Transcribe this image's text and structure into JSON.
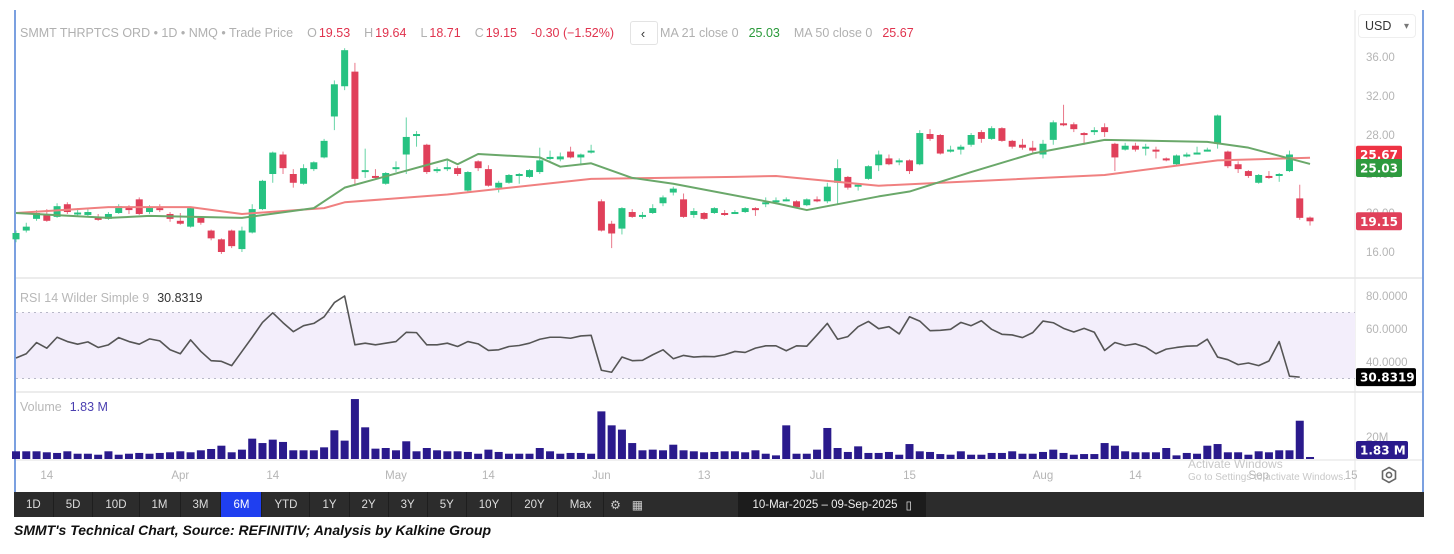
{
  "legend": {
    "symbol_line": "SMMT THRPTCS ORD • 1D • NMQ • Trade Price",
    "open_label": "O",
    "open": "19.53",
    "high_label": "H",
    "high": "19.64",
    "low_label": "L",
    "low": "18.71",
    "close_label": "C",
    "close": "19.15",
    "change": "-0.30 (−1.52%)",
    "back_icon": "‹",
    "ma21_label": "MA 21 close 0",
    "ma21_value": "25.03",
    "ma50_label": "MA 50 close 0",
    "ma50_value": "25.67"
  },
  "currency": {
    "value": "USD",
    "arrow": "▾"
  },
  "rsi_pane": {
    "label": "RSI 14 Wilder Simple 9",
    "value": "30.8319"
  },
  "volume_pane": {
    "label": "Volume",
    "value": "1.83 M"
  },
  "colors": {
    "up": "#26c281",
    "down": "#e0405a",
    "ma21": "#6aa86a",
    "ma50": "#f08080",
    "volume": "#2a1a8c",
    "rsi": "#555555",
    "accent": "#1f3ff0"
  },
  "toolbar": {
    "ranges": [
      "1D",
      "5D",
      "10D",
      "1M",
      "3M",
      "6M",
      "YTD",
      "1Y",
      "2Y",
      "3Y",
      "5Y",
      "10Y",
      "20Y",
      "Max"
    ],
    "active": "6M",
    "date_range": "10-Mar-2025  –  09-Sep-2025"
  },
  "watermark": {
    "line1": "Activate Windows",
    "line2": "Go to Settings to activate Windows."
  },
  "caption": "SMMT's Technical Chart, Source: REFINITIV; Analysis by Kalkine Group",
  "chart_data": {
    "type": "candlestick",
    "title": "SMMT THRPTCS ORD • 1D • NMQ • Trade Price",
    "date_range": [
      "10-Mar-2025",
      "09-Sep-2025"
    ],
    "x_tick_labels": [
      {
        "label": "14",
        "index": 3
      },
      {
        "label": "Apr",
        "index": 16
      },
      {
        "label": "14",
        "index": 25
      },
      {
        "label": "May",
        "index": 37
      },
      {
        "label": "14",
        "index": 46
      },
      {
        "label": "Jun",
        "index": 57
      },
      {
        "label": "13",
        "index": 67
      },
      {
        "label": "Jul",
        "index": 78
      },
      {
        "label": "15",
        "index": 87
      },
      {
        "label": "Aug",
        "index": 100
      },
      {
        "label": "14",
        "index": 109
      },
      {
        "label": "Sep",
        "index": 121
      },
      {
        "label": "15",
        "index": 130
      }
    ],
    "price_axis": {
      "ticks": [
        "36.00",
        "32.00",
        "28.00",
        "24.00",
        "20.00",
        "16.00"
      ],
      "range": [
        14.8,
        38.2
      ]
    },
    "price_markers": [
      {
        "label": "25.67",
        "value": 25.67,
        "color": "#ee3344"
      },
      {
        "label": "25.03",
        "value": 25.03,
        "color": "#2e9a3e"
      },
      {
        "label": "19.15",
        "value": 19.15,
        "color": "#e0405a"
      }
    ],
    "ohlc": [
      [
        17.3,
        18.2,
        17.0,
        17.95
      ],
      [
        18.2,
        19.0,
        18.0,
        18.6
      ],
      [
        19.4,
        20.3,
        19.2,
        20.0
      ],
      [
        19.8,
        20.4,
        19.1,
        19.2
      ],
      [
        19.6,
        21.0,
        19.5,
        20.7
      ],
      [
        20.9,
        21.1,
        19.9,
        20.1
      ],
      [
        20.0,
        20.5,
        19.6,
        20.05
      ],
      [
        19.8,
        20.4,
        19.6,
        20.1
      ],
      [
        19.5,
        19.9,
        19.2,
        19.4
      ],
      [
        19.4,
        20.1,
        19.3,
        19.9
      ],
      [
        20.0,
        20.9,
        19.9,
        20.7
      ],
      [
        20.6,
        20.8,
        19.9,
        20.3
      ],
      [
        21.4,
        21.6,
        19.8,
        19.9
      ],
      [
        20.1,
        20.8,
        19.9,
        20.6
      ],
      [
        20.5,
        20.9,
        20.1,
        20.4
      ],
      [
        19.9,
        20.1,
        19.1,
        19.4
      ],
      [
        19.2,
        20.0,
        18.8,
        18.9
      ],
      [
        18.6,
        20.6,
        18.5,
        20.5
      ],
      [
        19.5,
        19.6,
        18.8,
        19.0
      ],
      [
        18.2,
        18.3,
        17.2,
        17.4
      ],
      [
        17.3,
        17.4,
        15.8,
        16.0
      ],
      [
        18.2,
        18.3,
        16.4,
        16.6
      ],
      [
        16.3,
        18.6,
        16.0,
        18.2
      ],
      [
        18.0,
        20.9,
        17.9,
        20.4
      ],
      [
        20.4,
        23.4,
        20.3,
        23.3
      ],
      [
        24.0,
        26.3,
        23.1,
        26.2
      ],
      [
        26.0,
        26.3,
        24.0,
        24.6
      ],
      [
        24.0,
        24.5,
        22.6,
        23.1
      ],
      [
        23.0,
        25.0,
        22.9,
        24.6
      ],
      [
        24.5,
        25.3,
        24.3,
        25.2
      ],
      [
        25.7,
        27.6,
        25.6,
        27.4
      ],
      [
        29.9,
        33.6,
        28.5,
        33.2
      ],
      [
        33.0,
        36.9,
        32.6,
        36.7
      ],
      [
        34.5,
        35.4,
        22.8,
        23.5
      ],
      [
        24.3,
        26.6,
        23.6,
        24.4
      ],
      [
        23.8,
        24.5,
        23.5,
        23.7
      ],
      [
        23.0,
        24.2,
        22.9,
        24.1
      ],
      [
        24.5,
        25.3,
        24.2,
        24.7
      ],
      [
        26.0,
        29.8,
        24.0,
        27.8
      ],
      [
        28.0,
        28.4,
        26.8,
        28.1
      ],
      [
        27.0,
        27.1,
        24.0,
        24.2
      ],
      [
        24.4,
        24.7,
        24.1,
        24.5
      ],
      [
        24.6,
        25.4,
        24.3,
        24.7
      ],
      [
        24.6,
        24.8,
        23.8,
        24.0
      ],
      [
        22.3,
        24.3,
        22.2,
        24.2
      ],
      [
        25.3,
        25.4,
        24.3,
        24.6
      ],
      [
        24.5,
        24.9,
        22.7,
        22.8
      ],
      [
        22.6,
        23.3,
        22.1,
        23.1
      ],
      [
        23.1,
        24.0,
        23.0,
        23.9
      ],
      [
        23.9,
        24.1,
        23.0,
        24.0
      ],
      [
        23.7,
        24.5,
        23.6,
        24.4
      ],
      [
        24.2,
        26.7,
        24.0,
        25.4
      ],
      [
        25.7,
        26.4,
        25.4,
        25.75
      ],
      [
        25.5,
        26.2,
        25.3,
        25.8
      ],
      [
        26.3,
        26.8,
        25.6,
        25.7
      ],
      [
        25.7,
        26.1,
        24.9,
        26.0
      ],
      [
        26.2,
        27.0,
        26.1,
        26.4
      ],
      [
        21.2,
        21.4,
        18.1,
        18.2
      ],
      [
        18.9,
        19.2,
        16.4,
        17.9
      ],
      [
        18.4,
        20.6,
        17.8,
        20.5
      ],
      [
        20.1,
        20.4,
        19.5,
        19.6
      ],
      [
        19.7,
        20.1,
        19.4,
        19.8
      ],
      [
        20.0,
        20.9,
        19.9,
        20.5
      ],
      [
        21.0,
        21.8,
        20.7,
        21.6
      ],
      [
        22.1,
        22.7,
        21.8,
        22.5
      ],
      [
        21.4,
        22.0,
        19.5,
        19.6
      ],
      [
        19.8,
        20.5,
        19.5,
        20.2
      ],
      [
        20.0,
        20.1,
        19.3,
        19.4
      ],
      [
        20.0,
        20.6,
        19.9,
        20.5
      ],
      [
        20.0,
        20.3,
        19.7,
        19.9
      ],
      [
        20.0,
        20.3,
        19.9,
        20.1
      ],
      [
        20.1,
        20.6,
        20.0,
        20.5
      ],
      [
        20.5,
        20.6,
        19.7,
        20.4
      ],
      [
        21.0,
        21.6,
        20.6,
        21.1
      ],
      [
        21.1,
        21.6,
        20.9,
        21.3
      ],
      [
        21.3,
        21.6,
        21.2,
        21.4
      ],
      [
        21.2,
        21.3,
        20.5,
        20.6
      ],
      [
        20.8,
        21.5,
        20.7,
        21.4
      ],
      [
        21.4,
        21.7,
        21.1,
        21.3
      ],
      [
        21.2,
        23.1,
        21.0,
        22.7
      ],
      [
        23.1,
        25.5,
        20.9,
        24.6
      ],
      [
        23.7,
        23.8,
        22.4,
        22.6
      ],
      [
        22.8,
        23.0,
        22.3,
        22.9
      ],
      [
        23.5,
        24.9,
        23.4,
        24.8
      ],
      [
        24.9,
        26.4,
        24.3,
        26.0
      ],
      [
        25.6,
        26.0,
        24.9,
        25.0
      ],
      [
        25.2,
        25.6,
        24.9,
        25.4
      ],
      [
        25.4,
        25.5,
        24.0,
        24.3
      ],
      [
        25.0,
        28.5,
        24.9,
        28.2
      ],
      [
        28.1,
        28.6,
        27.4,
        27.6
      ],
      [
        28.0,
        28.1,
        26.0,
        26.1
      ],
      [
        26.4,
        26.9,
        26.2,
        26.5
      ],
      [
        26.5,
        27.0,
        26.0,
        26.8
      ],
      [
        27.0,
        28.2,
        26.8,
        28.0
      ],
      [
        28.3,
        28.5,
        27.2,
        27.6
      ],
      [
        27.6,
        28.9,
        27.5,
        28.7
      ],
      [
        28.7,
        28.8,
        27.3,
        27.4
      ],
      [
        27.4,
        27.5,
        26.6,
        26.8
      ],
      [
        27.0,
        27.6,
        26.5,
        26.7
      ],
      [
        26.7,
        27.4,
        26.2,
        26.4
      ],
      [
        26.0,
        27.5,
        25.6,
        27.1
      ],
      [
        27.5,
        29.5,
        27.0,
        29.3
      ],
      [
        29.2,
        31.1,
        28.9,
        29.0
      ],
      [
        29.1,
        29.3,
        28.3,
        28.6
      ],
      [
        28.2,
        28.3,
        27.0,
        28.0
      ],
      [
        28.3,
        28.8,
        28.0,
        28.5
      ],
      [
        28.8,
        29.2,
        27.8,
        28.3
      ],
      [
        27.1,
        27.2,
        24.3,
        25.7
      ],
      [
        26.5,
        27.2,
        26.4,
        26.9
      ],
      [
        26.9,
        27.2,
        26.3,
        26.5
      ],
      [
        26.7,
        27.1,
        25.9,
        26.8
      ],
      [
        26.5,
        26.8,
        25.6,
        26.4
      ],
      [
        25.6,
        25.7,
        25.3,
        25.5
      ],
      [
        25.0,
        26.0,
        24.9,
        25.9
      ],
      [
        25.9,
        26.2,
        25.7,
        26.0
      ],
      [
        26.1,
        26.8,
        26.0,
        26.2
      ],
      [
        26.4,
        26.7,
        26.3,
        26.5
      ],
      [
        27.1,
        30.1,
        26.6,
        30.0
      ],
      [
        26.3,
        26.4,
        24.6,
        24.8
      ],
      [
        25.0,
        25.3,
        24.1,
        24.5
      ],
      [
        24.3,
        24.4,
        23.6,
        23.8
      ],
      [
        23.1,
        24.0,
        23.0,
        23.9
      ],
      [
        23.8,
        24.3,
        23.5,
        23.6
      ],
      [
        23.9,
        24.1,
        23.2,
        24.0
      ],
      [
        24.3,
        26.4,
        24.2,
        26.0
      ],
      [
        21.5,
        22.9,
        19.3,
        19.5
      ],
      [
        19.53,
        19.64,
        18.71,
        19.15
      ]
    ],
    "ma21": [
      [
        0,
        20.0
      ],
      [
        9,
        19.5
      ],
      [
        13,
        19.7
      ],
      [
        22,
        19.5
      ],
      [
        29,
        20.5
      ],
      [
        30,
        21.2
      ],
      [
        32,
        22.6
      ],
      [
        42,
        25.5
      ],
      [
        43,
        25.0
      ],
      [
        45,
        26.05
      ],
      [
        51,
        25.7
      ],
      [
        53,
        24.75
      ],
      [
        56,
        25.1
      ],
      [
        60,
        23.6
      ],
      [
        64,
        23.0
      ],
      [
        74,
        21.0
      ],
      [
        77,
        20.3
      ],
      [
        84,
        21.7
      ],
      [
        87,
        22.2
      ],
      [
        93,
        24.2
      ],
      [
        99,
        26.1
      ],
      [
        106,
        27.5
      ],
      [
        116,
        27.3
      ],
      [
        120,
        26.7
      ],
      [
        126,
        25.03
      ]
    ],
    "ma50": [
      [
        0,
        20.0
      ],
      [
        9,
        20.6
      ],
      [
        17,
        20.6
      ],
      [
        22,
        19.9
      ],
      [
        30,
        20.5
      ],
      [
        32,
        21.1
      ],
      [
        42,
        21.9
      ],
      [
        56,
        23.5
      ],
      [
        70,
        23.7
      ],
      [
        74,
        23.8
      ],
      [
        84,
        22.8
      ],
      [
        106,
        23.9
      ],
      [
        117,
        25.4
      ],
      [
        126,
        25.67
      ]
    ],
    "rsi": {
      "label": "RSI 14 Wilder Simple 9",
      "ticks": [
        "80.0000",
        "60.0000",
        "40.0000"
      ],
      "band": [
        30,
        70
      ],
      "values": [
        42.4,
        45,
        51.8,
        48.4,
        55,
        52.4,
        50.8,
        52.2,
        48.8,
        50.4,
        54.8,
        52.4,
        50.8,
        54,
        52.8,
        47.4,
        45,
        53.4,
        46.4,
        40.8,
        40.4,
        37.8,
        46.4,
        55,
        64,
        69.8,
        63.8,
        58.4,
        62,
        63.4,
        67.4,
        76,
        80,
        50.4,
        51.4,
        50.4,
        51.4,
        52.4,
        58,
        57.8,
        50.4,
        50.4,
        51.4,
        49.4,
        52.4,
        51,
        47,
        47.4,
        49.4,
        50,
        51.4,
        53.8,
        55,
        55,
        54.4,
        55.8,
        56.2,
        35,
        33.8,
        43,
        40.8,
        41,
        44.4,
        47.4,
        42,
        44,
        43,
        43.4,
        43.2,
        44.4,
        46.4,
        45.8,
        48.4,
        49.8,
        49.8,
        46.8,
        49.8,
        49.6,
        56.4,
        63.4,
        53.8,
        55.4,
        61.4,
        64.6,
        60.2,
        61.4,
        57,
        67.4,
        64.8,
        59,
        59.2,
        59.8,
        64,
        62,
        65,
        59.8,
        56.8,
        56.4,
        54.8,
        57.8,
        64.8,
        63.8,
        60.4,
        58.2,
        60.4,
        58,
        47,
        51.8,
        50,
        51,
        49,
        45,
        47.8,
        48.8,
        49.6,
        49.8,
        53.8,
        43,
        41.4,
        38.4,
        39.4,
        37.8,
        40.6,
        52.4,
        31.4,
        30.8319
      ]
    },
    "volume": {
      "label": "Volume",
      "unit": "M",
      "ticks": [
        "20M"
      ],
      "values": [
        7.0,
        7.0,
        7.0,
        6.1,
        5.5,
        7.0,
        4.8,
        4.8,
        3.9,
        7.0,
        3.9,
        4.8,
        5.5,
        4.8,
        5.5,
        6.1,
        7.0,
        6.1,
        7.9,
        9.1,
        12.1,
        6.1,
        8.5,
        18.5,
        14.5,
        17.6,
        15.5,
        7.9,
        7.9,
        7.9,
        10.6,
        26.1,
        16.7,
        54.5,
        28.8,
        9.4,
        10.0,
        7.9,
        16.1,
        7.0,
        10.0,
        7.9,
        7.0,
        7.0,
        6.4,
        4.8,
        8.5,
        6.4,
        4.8,
        4.8,
        4.8,
        10.0,
        7.0,
        4.8,
        5.5,
        5.5,
        4.8,
        43.3,
        30.6,
        26.7,
        14.5,
        7.9,
        8.5,
        7.9,
        13.0,
        7.9,
        7.0,
        6.1,
        6.4,
        7.0,
        7.0,
        6.1,
        7.9,
        4.8,
        3.3,
        30.6,
        4.8,
        4.8,
        8.5,
        28.2,
        10.0,
        6.4,
        11.5,
        5.5,
        5.5,
        6.4,
        3.9,
        13.6,
        7.0,
        6.4,
        4.5,
        3.9,
        7.0,
        3.9,
        3.9,
        5.5,
        5.5,
        7.0,
        4.8,
        4.8,
        6.4,
        8.5,
        5.5,
        3.9,
        4.5,
        4.5,
        14.5,
        12.1,
        7.0,
        6.1,
        6.1,
        6.1,
        10.0,
        3.3,
        5.5,
        4.8,
        12.1,
        13.6,
        6.1,
        6.1,
        3.9,
        7.0,
        6.1,
        7.9,
        7.9,
        34.8,
        1.83
      ],
      "last_label": "1.83 M"
    }
  }
}
